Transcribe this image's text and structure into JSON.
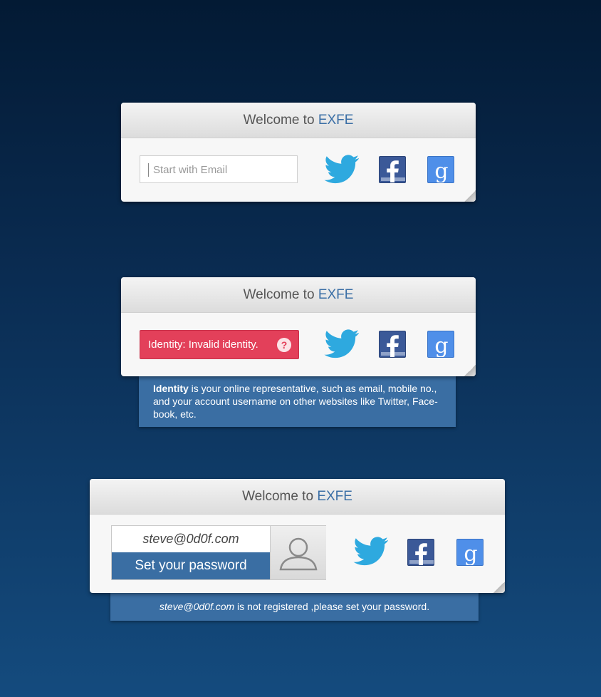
{
  "panel1": {
    "title": "Welcome to",
    "brand": "EXFE",
    "email_placeholder": "Start with Email"
  },
  "panel2": {
    "title": "Welcome to",
    "brand": "EXFE",
    "error_text": "Identity: Invalid identity.",
    "help_glyph": "?",
    "tooltip_bold": "Identity",
    "tooltip_line1": " is your online representative, such as email, mobile no.,",
    "tooltip_line2": "and your account username on other websites like Twitter, Face-",
    "tooltip_line3": "book, etc."
  },
  "panel3": {
    "title": "Welcome to",
    "brand": "EXFE",
    "email_value": "steve@0d0f.com",
    "set_password_label": "Set your password",
    "tooltip_email": "steve@0d0f.com",
    "tooltip_text": " is not registered ,please set your password."
  },
  "icons": {
    "twitter": "twitter-icon",
    "facebook": "facebook-icon",
    "google": "google-icon",
    "avatar": "user-avatar-icon"
  },
  "colors": {
    "brand": "#3b6fa6",
    "error": "#e3405a",
    "twitter": "#2ea9df",
    "facebook": "#3b5998",
    "google": "#4f8fe9",
    "tooltip": "#3a6ea3"
  }
}
